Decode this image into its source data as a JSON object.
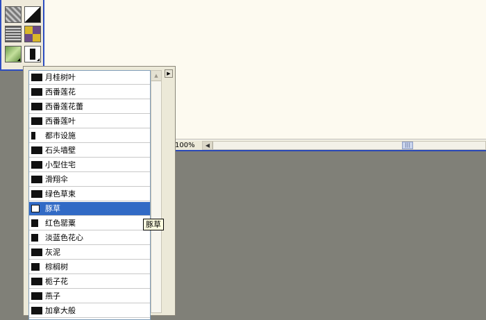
{
  "status_bar": {
    "zoom": "100%"
  },
  "scrollbar": {
    "left_arrow_glyph": "◀",
    "thumb_glyph": "|||",
    "up_arrow_glyph": "▲"
  },
  "panel": {
    "menu_arrow_glyph": "▶"
  },
  "tools": [
    {
      "icon": "gray-texture-icon"
    },
    {
      "icon": "black-white-split-icon"
    },
    {
      "icon": "striped-texture-icon"
    },
    {
      "icon": "purple-gold-pattern-icon"
    },
    {
      "icon": "green-leaf-icon"
    },
    {
      "icon": "black-stripe-icon"
    }
  ],
  "brush_list": {
    "items": [
      {
        "label": "月桂树叶"
      },
      {
        "label": "西番莲花"
      },
      {
        "label": "西番莲花蕾"
      },
      {
        "label": "西番莲叶"
      },
      {
        "label": "都市设施"
      },
      {
        "label": "石头墙壁"
      },
      {
        "label": "小型住宅"
      },
      {
        "label": "滑翔伞"
      },
      {
        "label": "绿色草束"
      },
      {
        "label": "豚草",
        "selected": true
      },
      {
        "label": "红色罂粟"
      },
      {
        "label": "淡蓝色花心"
      },
      {
        "label": "灰泥"
      },
      {
        "label": "棕榈树"
      },
      {
        "label": "栀子花"
      },
      {
        "label": "燕子"
      },
      {
        "label": "加拿大般"
      }
    ]
  },
  "tooltip": {
    "text": "豚草"
  },
  "colors": {
    "accent": "#316ac5",
    "border_blue": "#2c4cc1",
    "workspace": "#808078"
  }
}
